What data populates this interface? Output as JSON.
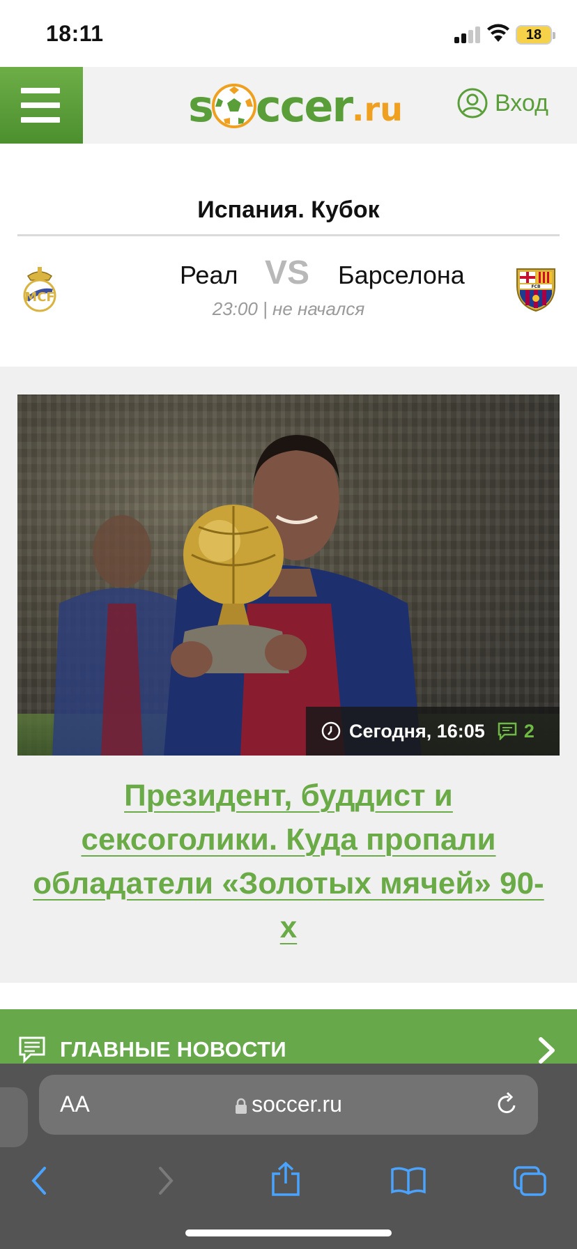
{
  "status_bar": {
    "time": "18:11",
    "battery": "18"
  },
  "header": {
    "logo_main": "soccer",
    "logo_ru": ".ru",
    "login_label": "Вход"
  },
  "match": {
    "tournament": "Испания. Кубок",
    "home_team": "Реал",
    "vs": "VS",
    "away_team": "Барселона",
    "status": "23:00 | не начался"
  },
  "article": {
    "date": "Сегодня, 16:05",
    "comments_count": "2",
    "headline": "Президент, буддист и сексоголики. Куда пропали обладатели «Золотых мячей» 90-х"
  },
  "news_section": {
    "label": "ГЛАВНЫЕ НОВОСТИ"
  },
  "browser": {
    "text_size_label": "AA",
    "url": "soccer.ru"
  },
  "colors": {
    "brand_green": "#66a84a",
    "logo_orange": "#f0a020",
    "vs_gray": "#b8b8b8"
  }
}
